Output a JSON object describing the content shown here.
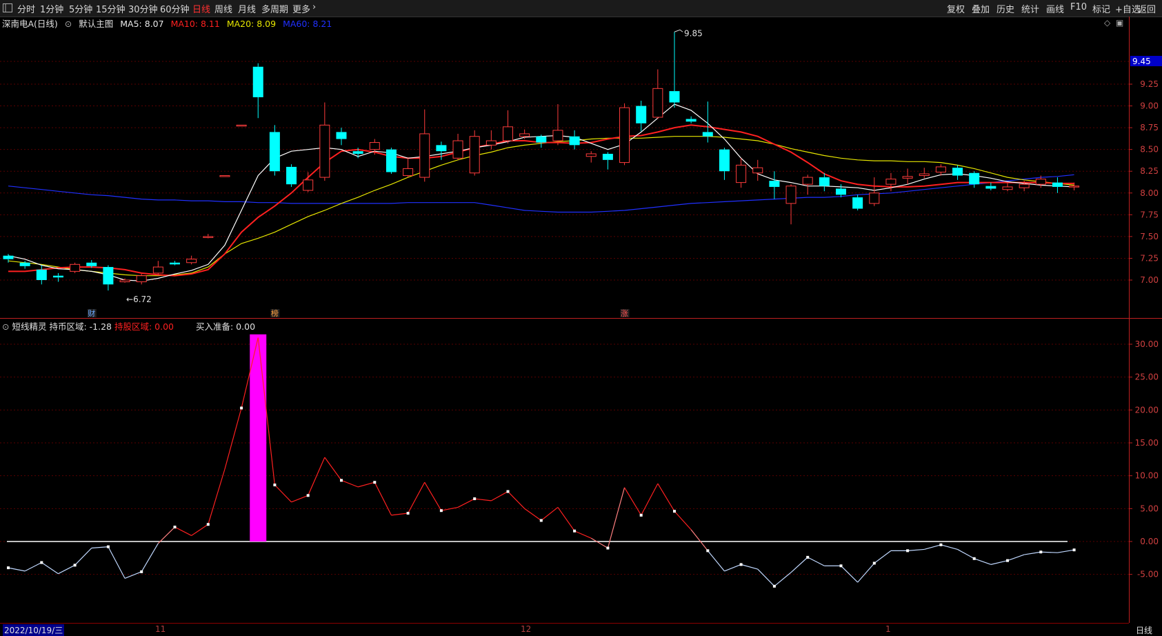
{
  "toolbar": {
    "menu_icon": "menu-icon",
    "periods": [
      "分时",
      "1分钟",
      "5分钟",
      "15分钟",
      "30分钟",
      "60分钟",
      "日线",
      "周线",
      "月线",
      "多周期",
      "更多"
    ],
    "active_period": "日线",
    "right_items": [
      "复权",
      "叠加",
      "历史",
      "统计",
      "画线",
      "F10",
      "标记",
      "+自选",
      "返回"
    ]
  },
  "main_info": {
    "stock": "深南电A(日线)",
    "template": "默认主图",
    "ma5": "MA5: 8.07",
    "ma10": "MA10: 8.11",
    "ma20": "MA20: 8.09",
    "ma60": "MA60: 8.21"
  },
  "sub_info": {
    "title": "短线精灵",
    "hold_cash": "持币区域: -1.28",
    "hold_stock": "持股区域: 0.00",
    "buy_ready": "买入准备: 0.00"
  },
  "colors": {
    "up": "#ff3c3c",
    "down": "#00ffff",
    "ma5": "#ffffff",
    "ma10": "#ff2020",
    "ma20": "#e6e600",
    "ma60": "#2030ff",
    "bar": "#ff00ff",
    "grid": "#5a0000"
  },
  "chart_data": [
    {
      "type": "candlestick",
      "ylim": [
        6.78,
        10.0
      ],
      "y_ticks": [
        "9.25",
        "9.00",
        "8.75",
        "8.50",
        "8.25",
        "8.00",
        "7.75",
        "7.50",
        "7.25",
        "7.00"
      ],
      "current_price": "9.45",
      "high_label": "9.85",
      "low_label": "6.72",
      "candles": [
        [
          7.28,
          7.24,
          7.3,
          7.2
        ],
        [
          7.2,
          7.16,
          7.22,
          7.13
        ],
        [
          7.12,
          7.0,
          7.17,
          6.95
        ],
        [
          7.05,
          7.03,
          7.08,
          6.98
        ],
        [
          7.1,
          7.18,
          7.2,
          7.08
        ],
        [
          7.2,
          7.16,
          7.23,
          7.14
        ],
        [
          7.15,
          6.95,
          7.17,
          6.88
        ],
        [
          6.98,
          7.0,
          7.02,
          6.97
        ],
        [
          6.98,
          7.05,
          7.07,
          6.95
        ],
        [
          7.08,
          7.15,
          7.22,
          7.05
        ],
        [
          7.2,
          7.18,
          7.22,
          7.17
        ],
        [
          7.2,
          7.24,
          7.28,
          7.18
        ],
        [
          7.5,
          7.5,
          7.53,
          7.48
        ],
        [
          8.2,
          8.2,
          8.2,
          8.2
        ],
        [
          8.78,
          8.78,
          8.78,
          8.78
        ],
        [
          9.45,
          9.1,
          9.49,
          8.86
        ],
        [
          8.7,
          8.25,
          8.78,
          8.2
        ],
        [
          8.3,
          8.1,
          8.33,
          8.07
        ],
        [
          8.03,
          8.15,
          8.24,
          8.01
        ],
        [
          8.18,
          8.78,
          9.04,
          8.14
        ],
        [
          8.7,
          8.62,
          8.75,
          8.55
        ],
        [
          8.48,
          8.45,
          8.52,
          8.4
        ],
        [
          8.5,
          8.58,
          8.62,
          8.44
        ],
        [
          8.5,
          8.24,
          8.52,
          8.22
        ],
        [
          8.2,
          8.28,
          8.4,
          8.18
        ],
        [
          8.18,
          8.68,
          8.96,
          8.13
        ],
        [
          8.55,
          8.48,
          8.59,
          8.38
        ],
        [
          8.4,
          8.6,
          8.68,
          8.38
        ],
        [
          8.23,
          8.65,
          8.72,
          8.2
        ],
        [
          8.55,
          8.6,
          8.72,
          8.5
        ],
        [
          8.6,
          8.76,
          8.95,
          8.57
        ],
        [
          8.65,
          8.68,
          8.73,
          8.62
        ],
        [
          8.65,
          8.58,
          8.67,
          8.52
        ],
        [
          8.6,
          8.72,
          9.02,
          8.55
        ],
        [
          8.65,
          8.55,
          8.72,
          8.5
        ],
        [
          8.42,
          8.45,
          8.48,
          8.35
        ],
        [
          8.45,
          8.38,
          8.47,
          8.27
        ],
        [
          8.35,
          8.98,
          9.03,
          8.32
        ],
        [
          9.0,
          8.8,
          9.06,
          8.71
        ],
        [
          8.87,
          9.2,
          9.42,
          8.85
        ],
        [
          9.17,
          9.04,
          9.85,
          8.98
        ],
        [
          8.85,
          8.82,
          8.88,
          8.8
        ],
        [
          8.7,
          8.65,
          9.05,
          8.58
        ],
        [
          8.5,
          8.25,
          8.52,
          8.15
        ],
        [
          8.12,
          8.32,
          8.4,
          8.06
        ],
        [
          8.23,
          8.29,
          8.38,
          8.14
        ],
        [
          8.14,
          8.07,
          8.25,
          7.93
        ],
        [
          7.88,
          8.08,
          8.1,
          7.64
        ],
        [
          8.1,
          8.18,
          8.21,
          7.98
        ],
        [
          8.18,
          8.08,
          8.23,
          8.02
        ],
        [
          8.05,
          7.98,
          8.1,
          7.95
        ],
        [
          7.95,
          7.82,
          7.98,
          7.8
        ],
        [
          7.88,
          8.0,
          8.18,
          7.85
        ],
        [
          8.1,
          8.16,
          8.23,
          8.02
        ],
        [
          8.17,
          8.19,
          8.28,
          8.1
        ],
        [
          8.2,
          8.22,
          8.29,
          8.17
        ],
        [
          8.24,
          8.3,
          8.33,
          8.2
        ],
        [
          8.29,
          8.2,
          8.32,
          8.15
        ],
        [
          8.23,
          8.1,
          8.25,
          8.06
        ],
        [
          8.08,
          8.05,
          8.12,
          8.03
        ],
        [
          8.04,
          8.07,
          8.12,
          8.02
        ],
        [
          8.06,
          8.1,
          8.14,
          8.02
        ],
        [
          8.1,
          8.16,
          8.2,
          8.06
        ],
        [
          8.12,
          8.07,
          8.18,
          8.0
        ],
        [
          8.08,
          8.08,
          8.12,
          8.03
        ]
      ],
      "ma5": [
        7.28,
        7.24,
        7.17,
        7.13,
        7.12,
        7.1,
        7.06,
        7.0,
        6.99,
        7.02,
        7.07,
        7.11,
        7.18,
        7.4,
        7.8,
        8.2,
        8.4,
        8.48,
        8.5,
        8.52,
        8.5,
        8.42,
        8.48,
        8.46,
        8.4,
        8.42,
        8.45,
        8.48,
        8.52,
        8.55,
        8.59,
        8.64,
        8.65,
        8.66,
        8.64,
        8.57,
        8.5,
        8.56,
        8.7,
        8.86,
        9.02,
        8.95,
        8.8,
        8.62,
        8.4,
        8.22,
        8.15,
        8.12,
        8.08,
        8.08,
        8.07,
        8.06,
        8.03,
        8.06,
        8.1,
        8.16,
        8.21,
        8.22,
        8.2,
        8.17,
        8.13,
        8.11,
        8.09,
        8.08,
        8.07
      ],
      "ma10": [
        7.1,
        7.1,
        7.12,
        7.14,
        7.15,
        7.15,
        7.14,
        7.12,
        7.08,
        7.06,
        7.05,
        7.07,
        7.12,
        7.3,
        7.55,
        7.72,
        7.85,
        8.0,
        8.18,
        8.35,
        8.48,
        8.5,
        8.47,
        8.42,
        8.4,
        8.4,
        8.42,
        8.47,
        8.52,
        8.56,
        8.6,
        8.6,
        8.58,
        8.58,
        8.57,
        8.58,
        8.62,
        8.65,
        8.66,
        8.7,
        8.75,
        8.78,
        8.76,
        8.73,
        8.7,
        8.65,
        8.56,
        8.47,
        8.35,
        8.22,
        8.14,
        8.1,
        8.08,
        8.07,
        8.07,
        8.08,
        8.1,
        8.12,
        8.12,
        8.12,
        8.12,
        8.12,
        8.12,
        8.11,
        8.11
      ],
      "ma20": [
        7.22,
        7.2,
        7.18,
        7.15,
        7.12,
        7.1,
        7.08,
        7.06,
        7.05,
        7.05,
        7.06,
        7.08,
        7.15,
        7.3,
        7.42,
        7.48,
        7.55,
        7.64,
        7.73,
        7.8,
        7.88,
        7.95,
        8.03,
        8.1,
        8.18,
        8.25,
        8.32,
        8.38,
        8.43,
        8.47,
        8.52,
        8.55,
        8.57,
        8.59,
        8.6,
        8.62,
        8.63,
        8.63,
        8.63,
        8.64,
        8.65,
        8.65,
        8.65,
        8.64,
        8.62,
        8.6,
        8.56,
        8.51,
        8.47,
        8.43,
        8.4,
        8.38,
        8.37,
        8.37,
        8.36,
        8.36,
        8.35,
        8.32,
        8.28,
        8.23,
        8.18,
        8.15,
        8.13,
        8.11,
        8.09
      ],
      "ma60": [
        8.08,
        8.06,
        8.04,
        8.02,
        8.0,
        7.98,
        7.97,
        7.95,
        7.93,
        7.92,
        7.92,
        7.91,
        7.91,
        7.9,
        7.9,
        7.89,
        7.89,
        7.88,
        7.88,
        7.88,
        7.88,
        7.88,
        7.88,
        7.88,
        7.89,
        7.89,
        7.89,
        7.89,
        7.89,
        7.86,
        7.83,
        7.8,
        7.79,
        7.78,
        7.78,
        7.78,
        7.79,
        7.8,
        7.82,
        7.84,
        7.86,
        7.88,
        7.89,
        7.9,
        7.91,
        7.92,
        7.93,
        7.94,
        7.95,
        7.95,
        7.96,
        7.98,
        7.99,
        8.0,
        8.02,
        8.04,
        8.06,
        8.08,
        8.1,
        8.12,
        8.14,
        8.16,
        8.18,
        8.19,
        8.21
      ],
      "markers": [
        {
          "label": "财",
          "index": 5
        },
        {
          "label": "榜",
          "index": 16
        },
        {
          "label": "涨",
          "index": 37
        }
      ]
    },
    {
      "type": "line",
      "title": "短线精灵",
      "ylim": [
        -8.0,
        32.0
      ],
      "y_ticks": [
        "30.00",
        "25.00",
        "20.00",
        "15.00",
        "10.00",
        "5.00",
        "0.00",
        "-5.00"
      ],
      "values": [
        -4.0,
        -4.5,
        -3.2,
        -4.9,
        -3.6,
        -1.0,
        -0.8,
        -5.6,
        -4.6,
        -0.3,
        2.2,
        0.9,
        2.6,
        11.0,
        20.3,
        31.0,
        8.6,
        6.0,
        7.0,
        12.8,
        9.3,
        8.3,
        9.0,
        4.0,
        4.3,
        9.0,
        4.7,
        5.2,
        6.5,
        6.2,
        7.6,
        5.0,
        3.2,
        5.2,
        1.6,
        0.5,
        -1.0,
        8.2,
        4.0,
        8.8,
        4.6,
        1.8,
        -1.4,
        -4.5,
        -3.5,
        -4.2,
        -6.8,
        -4.7,
        -2.4,
        -3.7,
        -3.7,
        -6.2,
        -3.3,
        -1.4,
        -1.4,
        -1.2,
        -0.5,
        -1.2,
        -2.6,
        -3.5,
        -2.9,
        -2.0,
        -1.6,
        -1.7,
        -1.28
      ],
      "bar": {
        "index": 15,
        "value": 31.5
      }
    }
  ],
  "x_labels": [
    "2022/10/19/三",
    "11",
    "12",
    "1"
  ],
  "bottom_right": "日线"
}
